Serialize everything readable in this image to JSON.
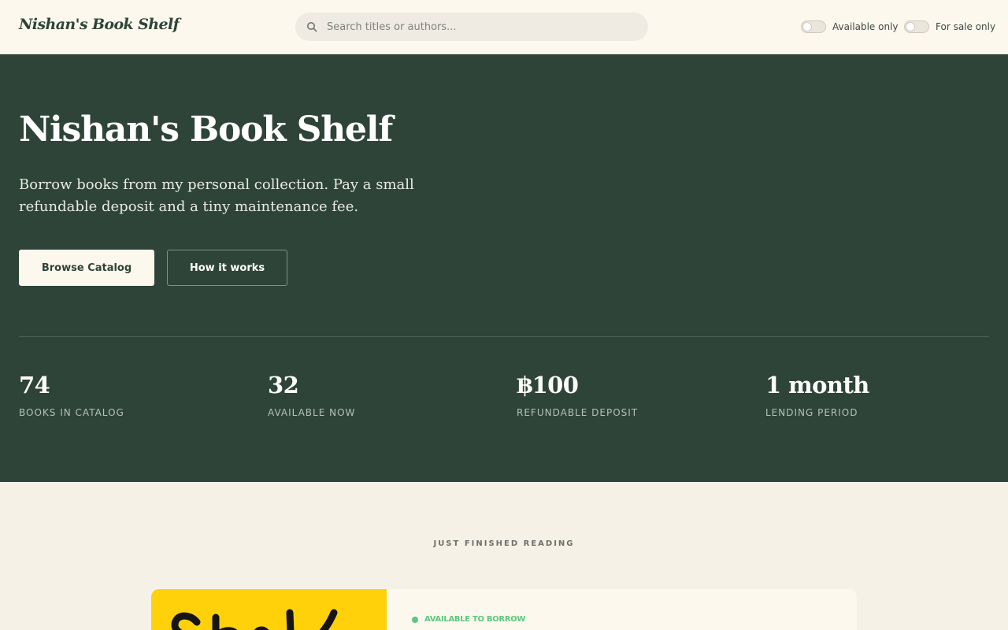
{
  "header": {
    "brand": "Nishan's Book Shelf",
    "search_placeholder": "Search titles or authors...",
    "toggles": [
      {
        "label": "Available only",
        "on": false
      },
      {
        "label": "For sale only",
        "on": false
      }
    ]
  },
  "hero": {
    "title": "Nishan's Book Shelf",
    "subtitle": "Borrow books from my personal collection. Pay a small refundable deposit and a tiny maintenance fee.",
    "primary_button": "Browse Catalog",
    "secondary_button": "How it works",
    "stats": [
      {
        "value": "74",
        "label": "BOOKS IN CATALOG"
      },
      {
        "value": "32",
        "label": "AVAILABLE NOW"
      },
      {
        "value": "฿100",
        "label": "REFUNDABLE DEPOSIT"
      },
      {
        "value": "1 month",
        "label": "LENDING PERIOD"
      }
    ]
  },
  "featured": {
    "section_label": "JUST FINISHED READING",
    "availability": "AVAILABLE TO BORROW"
  },
  "colors": {
    "primary_green": "#2e4438",
    "cream": "#fcf8ee",
    "page_background": "#f6f1e6",
    "available_green": "#5bc77f",
    "cover_yellow": "#ffd10a"
  }
}
